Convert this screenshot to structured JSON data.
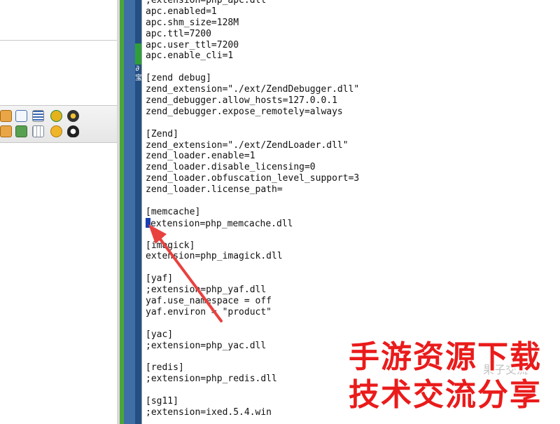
{
  "editor": {
    "lines": [
      ";extension=php_apc.dll",
      "apc.enabled=1",
      "apc.shm_size=128M",
      "apc.ttl=7200",
      "apc.user_ttl=7200",
      "apc.enable_cli=1",
      "",
      "[zend debug]",
      "zend_extension=\"./ext/ZendDebugger.dll\"",
      "zend_debugger.allow_hosts=127.0.0.1",
      "zend_debugger.expose_remotely=always",
      "",
      "[Zend]",
      "zend_extension=\"./ext/ZendLoader.dll\"",
      "zend_loader.enable=1",
      "zend_loader.disable_licensing=0",
      "zend_loader.obfuscation_level_support=3",
      "zend_loader.license_path=",
      "",
      "[memcache]",
      "extension=php_memcache.dll",
      "",
      "[imagick]",
      "extension=php_imagick.dll",
      "",
      "[yaf]",
      ";extension=php_yaf.dll",
      "yaf.use_namespace = off",
      "yaf.environ = \"product\"",
      "",
      "[yac]",
      ";extension=php_yac.dll",
      "",
      "[redis]",
      ";extension=php_redis.dll",
      "",
      "[sg11]",
      ";extension=ixed.5.4.win"
    ],
    "caret_line_index": 20
  },
  "strip": {
    "glyph1": "∂",
    "glyph2": "宝"
  },
  "watermark": {
    "line1": "手游资源下载",
    "line2": "技术交流分享",
    "ghost": "果子交流",
    "color": "#ea1b1b"
  },
  "toolbar_icons": [
    "table-icon",
    "document-icon",
    "list-icon",
    "key-icon",
    "disc-icon",
    "lock-icon",
    "image-icon",
    "grid-icon",
    "bg-icon",
    "penguin-icon"
  ],
  "colors": {
    "caret": "#1a3fb0",
    "arrow": "#e8413f",
    "strip_blue": "#3f6fa6",
    "strip_green": "#4aa63a"
  }
}
